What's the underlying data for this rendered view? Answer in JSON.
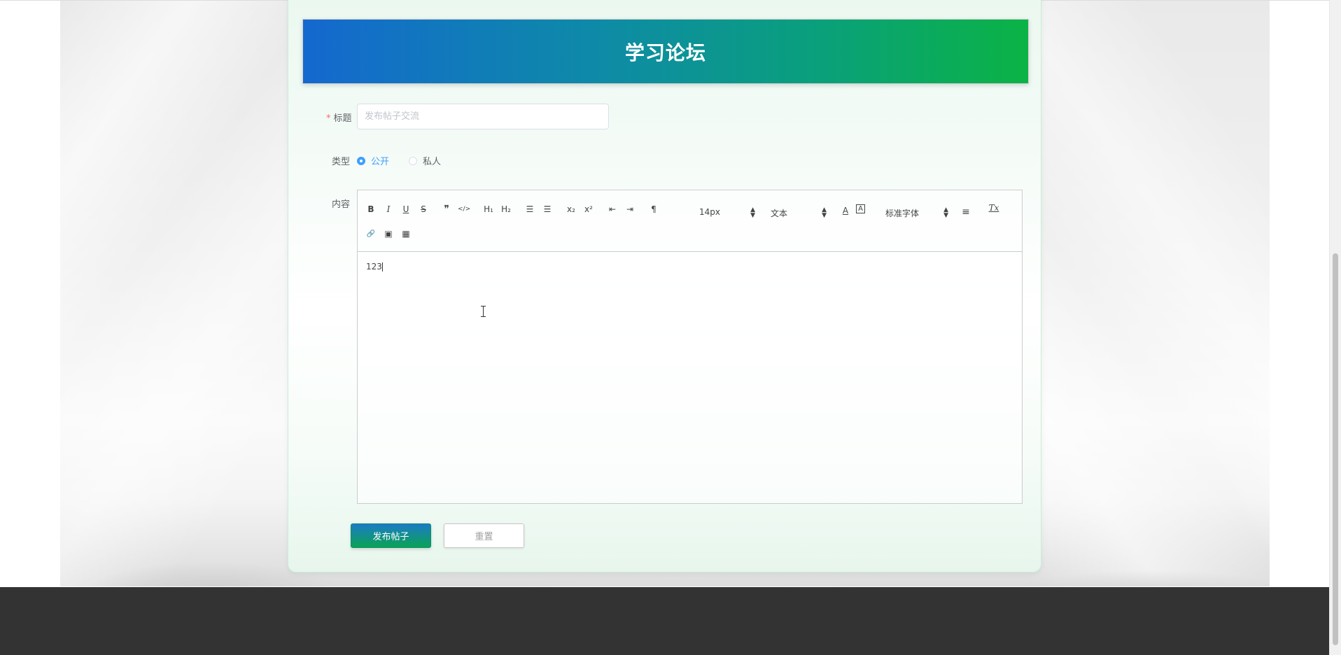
{
  "forum": {
    "title": "学习论坛"
  },
  "form": {
    "title_label": "标题",
    "required_mark": "*",
    "title_placeholder": "发布帖子交流",
    "title_value": "",
    "type_label": "类型",
    "type_options": [
      {
        "label": "公开",
        "selected": true
      },
      {
        "label": "私人",
        "selected": false
      }
    ],
    "content_label": "内容"
  },
  "editor": {
    "toolbar": {
      "bold": "B",
      "italic": "I",
      "underline": "U",
      "strike": "S",
      "quote": "❞",
      "code": "</>",
      "h1": "H₁",
      "h2": "H₂",
      "ordered_list": "☰",
      "bullet_list": "☰",
      "sub": "x₂",
      "sup": "x²",
      "outdent": "⇤",
      "indent": "⇥",
      "direction": "¶",
      "size_picker": "14px",
      "header_picker": "文本",
      "font_picker": "标准字体",
      "color": "A",
      "background": "A",
      "align": "≡",
      "clean": "Tx",
      "link": "🔗",
      "image": "▣",
      "video": "▦"
    },
    "content": "123"
  },
  "buttons": {
    "submit": "发布帖子",
    "reset": "重置"
  },
  "colors": {
    "banner_start": "#1468cf",
    "banner_end": "#0bb345",
    "primary": "#409eff",
    "required": "#f56c6c",
    "footer": "#333333"
  }
}
